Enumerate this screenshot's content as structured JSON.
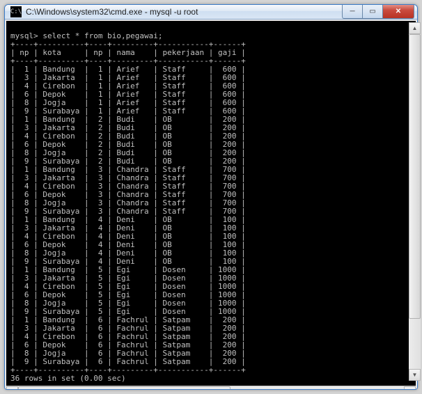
{
  "window": {
    "title": "C:\\Windows\\system32\\cmd.exe - mysql  -u root"
  },
  "prompt": "mysql> ",
  "query": "select * from bio,pegawai;",
  "headers": {
    "np1": "np",
    "kota": "kota",
    "np2": "np",
    "nama": "nama",
    "pekerjaan": "pekerjaan",
    "gaji": "gaji"
  },
  "rows": [
    {
      "np1": "1",
      "kota": "Bandung",
      "np2": "1",
      "nama": "Arief",
      "pekerjaan": "Staff",
      "gaji": "600"
    },
    {
      "np1": "3",
      "kota": "Jakarta",
      "np2": "1",
      "nama": "Arief",
      "pekerjaan": "Staff",
      "gaji": "600"
    },
    {
      "np1": "4",
      "kota": "Cirebon",
      "np2": "1",
      "nama": "Arief",
      "pekerjaan": "Staff",
      "gaji": "600"
    },
    {
      "np1": "6",
      "kota": "Depok",
      "np2": "1",
      "nama": "Arief",
      "pekerjaan": "Staff",
      "gaji": "600"
    },
    {
      "np1": "8",
      "kota": "Jogja",
      "np2": "1",
      "nama": "Arief",
      "pekerjaan": "Staff",
      "gaji": "600"
    },
    {
      "np1": "9",
      "kota": "Surabaya",
      "np2": "1",
      "nama": "Arief",
      "pekerjaan": "Staff",
      "gaji": "600"
    },
    {
      "np1": "1",
      "kota": "Bandung",
      "np2": "2",
      "nama": "Budi",
      "pekerjaan": "OB",
      "gaji": "200"
    },
    {
      "np1": "3",
      "kota": "Jakarta",
      "np2": "2",
      "nama": "Budi",
      "pekerjaan": "OB",
      "gaji": "200"
    },
    {
      "np1": "4",
      "kota": "Cirebon",
      "np2": "2",
      "nama": "Budi",
      "pekerjaan": "OB",
      "gaji": "200"
    },
    {
      "np1": "6",
      "kota": "Depok",
      "np2": "2",
      "nama": "Budi",
      "pekerjaan": "OB",
      "gaji": "200"
    },
    {
      "np1": "8",
      "kota": "Jogja",
      "np2": "2",
      "nama": "Budi",
      "pekerjaan": "OB",
      "gaji": "200"
    },
    {
      "np1": "9",
      "kota": "Surabaya",
      "np2": "2",
      "nama": "Budi",
      "pekerjaan": "OB",
      "gaji": "200"
    },
    {
      "np1": "1",
      "kota": "Bandung",
      "np2": "3",
      "nama": "Chandra",
      "pekerjaan": "Staff",
      "gaji": "700"
    },
    {
      "np1": "3",
      "kota": "Jakarta",
      "np2": "3",
      "nama": "Chandra",
      "pekerjaan": "Staff",
      "gaji": "700"
    },
    {
      "np1": "4",
      "kota": "Cirebon",
      "np2": "3",
      "nama": "Chandra",
      "pekerjaan": "Staff",
      "gaji": "700"
    },
    {
      "np1": "6",
      "kota": "Depok",
      "np2": "3",
      "nama": "Chandra",
      "pekerjaan": "Staff",
      "gaji": "700"
    },
    {
      "np1": "8",
      "kota": "Jogja",
      "np2": "3",
      "nama": "Chandra",
      "pekerjaan": "Staff",
      "gaji": "700"
    },
    {
      "np1": "9",
      "kota": "Surabaya",
      "np2": "3",
      "nama": "Chandra",
      "pekerjaan": "Staff",
      "gaji": "700"
    },
    {
      "np1": "1",
      "kota": "Bandung",
      "np2": "4",
      "nama": "Deni",
      "pekerjaan": "OB",
      "gaji": "100"
    },
    {
      "np1": "3",
      "kota": "Jakarta",
      "np2": "4",
      "nama": "Deni",
      "pekerjaan": "OB",
      "gaji": "100"
    },
    {
      "np1": "4",
      "kota": "Cirebon",
      "np2": "4",
      "nama": "Deni",
      "pekerjaan": "OB",
      "gaji": "100"
    },
    {
      "np1": "6",
      "kota": "Depok",
      "np2": "4",
      "nama": "Deni",
      "pekerjaan": "OB",
      "gaji": "100"
    },
    {
      "np1": "8",
      "kota": "Jogja",
      "np2": "4",
      "nama": "Deni",
      "pekerjaan": "OB",
      "gaji": "100"
    },
    {
      "np1": "9",
      "kota": "Surabaya",
      "np2": "4",
      "nama": "Deni",
      "pekerjaan": "OB",
      "gaji": "100"
    },
    {
      "np1": "1",
      "kota": "Bandung",
      "np2": "5",
      "nama": "Egi",
      "pekerjaan": "Dosen",
      "gaji": "1000"
    },
    {
      "np1": "3",
      "kota": "Jakarta",
      "np2": "5",
      "nama": "Egi",
      "pekerjaan": "Dosen",
      "gaji": "1000"
    },
    {
      "np1": "4",
      "kota": "Cirebon",
      "np2": "5",
      "nama": "Egi",
      "pekerjaan": "Dosen",
      "gaji": "1000"
    },
    {
      "np1": "6",
      "kota": "Depok",
      "np2": "5",
      "nama": "Egi",
      "pekerjaan": "Dosen",
      "gaji": "1000"
    },
    {
      "np1": "8",
      "kota": "Jogja",
      "np2": "5",
      "nama": "Egi",
      "pekerjaan": "Dosen",
      "gaji": "1000"
    },
    {
      "np1": "9",
      "kota": "Surabaya",
      "np2": "5",
      "nama": "Egi",
      "pekerjaan": "Dosen",
      "gaji": "1000"
    },
    {
      "np1": "1",
      "kota": "Bandung",
      "np2": "6",
      "nama": "Fachrul",
      "pekerjaan": "Satpam",
      "gaji": "200"
    },
    {
      "np1": "3",
      "kota": "Jakarta",
      "np2": "6",
      "nama": "Fachrul",
      "pekerjaan": "Satpam",
      "gaji": "200"
    },
    {
      "np1": "4",
      "kota": "Cirebon",
      "np2": "6",
      "nama": "Fachrul",
      "pekerjaan": "Satpam",
      "gaji": "200"
    },
    {
      "np1": "6",
      "kota": "Depok",
      "np2": "6",
      "nama": "Fachrul",
      "pekerjaan": "Satpam",
      "gaji": "200"
    },
    {
      "np1": "8",
      "kota": "Jogja",
      "np2": "6",
      "nama": "Fachrul",
      "pekerjaan": "Satpam",
      "gaji": "200"
    },
    {
      "np1": "9",
      "kota": "Surabaya",
      "np2": "6",
      "nama": "Fachrul",
      "pekerjaan": "Satpam",
      "gaji": "200"
    }
  ],
  "footer": "36 rows in set (0.00 sec)"
}
